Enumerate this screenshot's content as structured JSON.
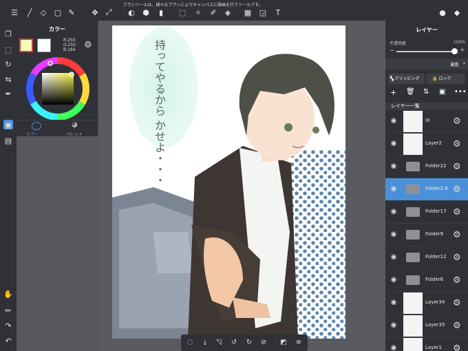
{
  "notice": "ブラシツールは、様々なブラシによりキャンバスに描画を行うツールです。",
  "colorPanel": {
    "title": "カラー",
    "rgb": {
      "r": "R:250",
      "g": "G:255",
      "b": "B:184"
    },
    "tabs": {
      "color": "カラー",
      "palette": "パレット"
    },
    "primary": "#fafab8",
    "secondary": "#ffffff"
  },
  "layerPanel": {
    "title": "レイヤー",
    "opacityLabel": "不透明度",
    "opacityValue": "100%",
    "blend": "通過",
    "clipping": "クリッピング",
    "lock": "ロック",
    "listTitle": "レイヤー一覧",
    "opacity": 1.0
  },
  "layers": [
    {
      "name": "III",
      "type": "layer",
      "selected": false
    },
    {
      "name": "Layer2",
      "type": "layer",
      "selected": false
    },
    {
      "name": "Folder22",
      "type": "folder",
      "selected": false
    },
    {
      "name": "Folder2 6",
      "type": "folder",
      "selected": true
    },
    {
      "name": "Folder17",
      "type": "folder",
      "selected": false
    },
    {
      "name": "Folder9",
      "type": "folder",
      "selected": false
    },
    {
      "name": "Folder12",
      "type": "folder",
      "selected": false
    },
    {
      "name": "Folder6",
      "type": "folder",
      "selected": false
    },
    {
      "name": "Layer34",
      "type": "layer",
      "selected": false
    },
    {
      "name": "Layer35",
      "type": "layer",
      "selected": false
    },
    {
      "name": "Layer1",
      "type": "layer",
      "selected": false
    }
  ],
  "canvasText": {
    "line1": "持ってやるから",
    "line2": "かせよ・・・"
  }
}
